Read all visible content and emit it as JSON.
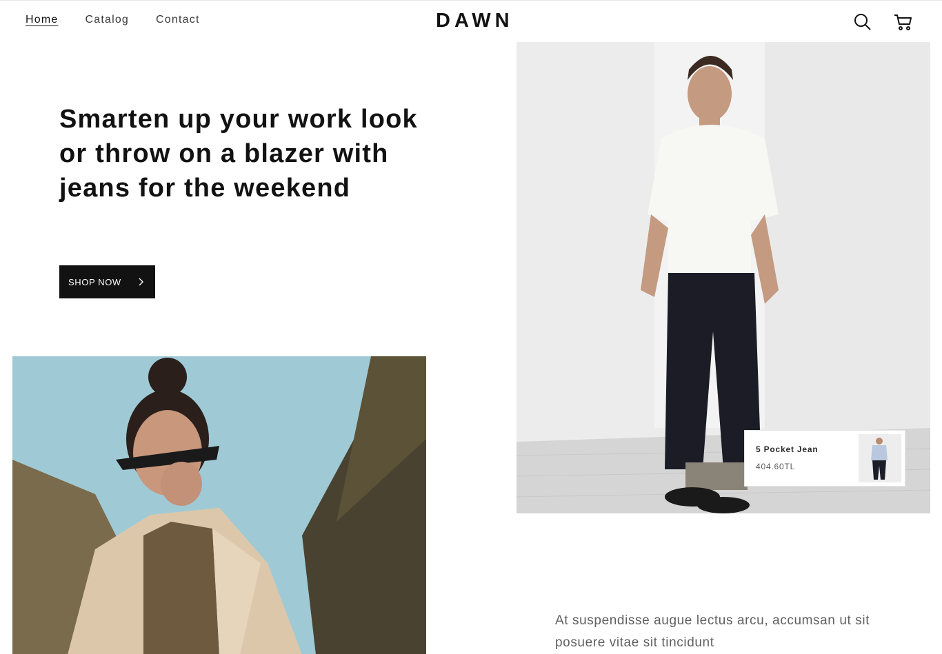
{
  "header": {
    "nav": [
      {
        "label": "Home",
        "active": true
      },
      {
        "label": "Catalog",
        "active": false
      },
      {
        "label": "Contact",
        "active": false
      }
    ],
    "logo": "DAWN",
    "icons": {
      "search": "search-icon",
      "cart": "cart-icon"
    }
  },
  "hero": {
    "heading": "Smarten up your work look or throw on a blazer with jeans for the weekend",
    "button_label": "SHOP NOW",
    "button_icon": "chevron-right-icon"
  },
  "product_card": {
    "name": "5 Pocket Jean",
    "price": "404.60TL"
  },
  "body": {
    "text": "At suspendisse augue lectus arcu, accumsan ut sit posuere vitae sit tincidunt"
  },
  "colors": {
    "text": "#121212",
    "button_bg": "#121212",
    "button_text": "#ffffff",
    "muted_text": "#606060"
  }
}
